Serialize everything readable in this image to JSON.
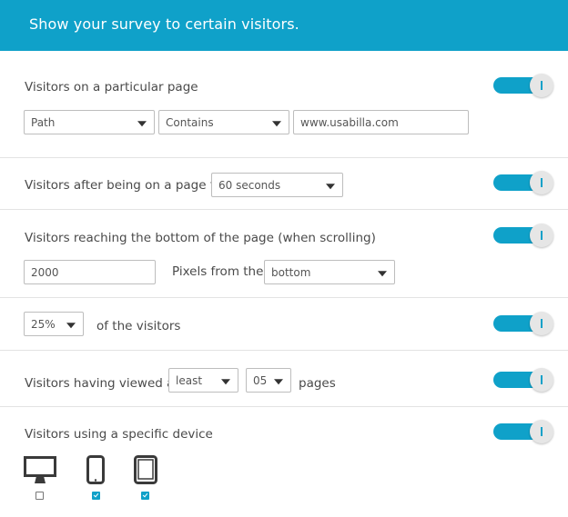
{
  "header": {
    "title": "Show your survey to certain visitors."
  },
  "colors": {
    "accent": "#0fa1c9",
    "text": "#4a4a4a",
    "divider": "#e3e3e3"
  },
  "rules": {
    "page": {
      "label": "Visitors on a particular page",
      "enabled": true,
      "field_select": "Path",
      "operator_select": "Contains",
      "url_input": "www.usabilla.com"
    },
    "time": {
      "label": "Visitors after being on a page for",
      "duration_select": "60 seconds",
      "enabled": true
    },
    "scroll": {
      "label": "Visitors reaching the bottom of the page (when scrolling)",
      "enabled": true,
      "pixels_input": "2000",
      "pixels_label": "Pixels from the",
      "position_select": "bottom"
    },
    "percentage": {
      "percent_select": "25%",
      "label": "of the visitors",
      "enabled": true
    },
    "pageviews": {
      "label_prefix": "Visitors having viewed at",
      "comparator_select": "least",
      "count_select": "05",
      "label_suffix": "pages",
      "enabled": true
    },
    "device": {
      "label": "Visitors using a specific device",
      "enabled": true,
      "devices": [
        {
          "icon": "desktop-icon",
          "checked": false
        },
        {
          "icon": "mobile-phone-icon",
          "checked": true
        },
        {
          "icon": "tablet-icon",
          "checked": true
        }
      ]
    }
  }
}
